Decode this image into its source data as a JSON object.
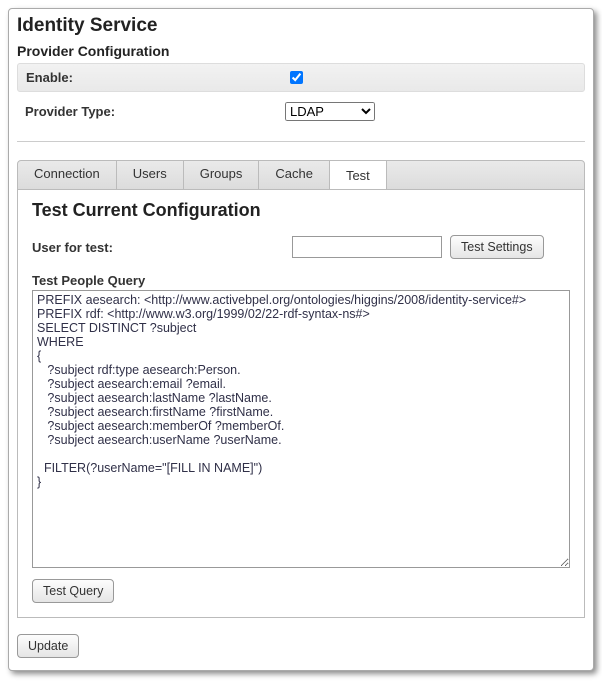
{
  "header": {
    "title": "Identity Service",
    "subtitle": "Provider Configuration"
  },
  "config": {
    "enable_label": "Enable:",
    "enable_checked": true,
    "provider_type_label": "Provider Type:",
    "provider_type_value": "LDAP",
    "provider_type_options": [
      "LDAP"
    ]
  },
  "tabs": [
    {
      "label": "Connection",
      "active": false
    },
    {
      "label": "Users",
      "active": false
    },
    {
      "label": "Groups",
      "active": false
    },
    {
      "label": "Cache",
      "active": false
    },
    {
      "label": "Test",
      "active": true
    }
  ],
  "test_tab": {
    "heading": "Test Current Configuration",
    "user_label": "User for test:",
    "user_value": "",
    "test_settings_button": "Test Settings",
    "query_label": "Test People Query",
    "query_text": "PREFIX aesearch: <http://www.activebpel.org/ontologies/higgins/2008/identity-service#>\nPREFIX rdf: <http://www.w3.org/1999/02/22-rdf-syntax-ns#>\nSELECT DISTINCT ?subject\nWHERE\n{\n   ?subject rdf:type aesearch:Person.\n   ?subject aesearch:email ?email.\n   ?subject aesearch:lastName ?lastName.\n   ?subject aesearch:firstName ?firstName.\n   ?subject aesearch:memberOf ?memberOf.\n   ?subject aesearch:userName ?userName.\n\n  FILTER(?userName=\"[FILL IN NAME]\")\n}",
    "test_query_button": "Test Query"
  },
  "footer": {
    "update_button": "Update"
  }
}
